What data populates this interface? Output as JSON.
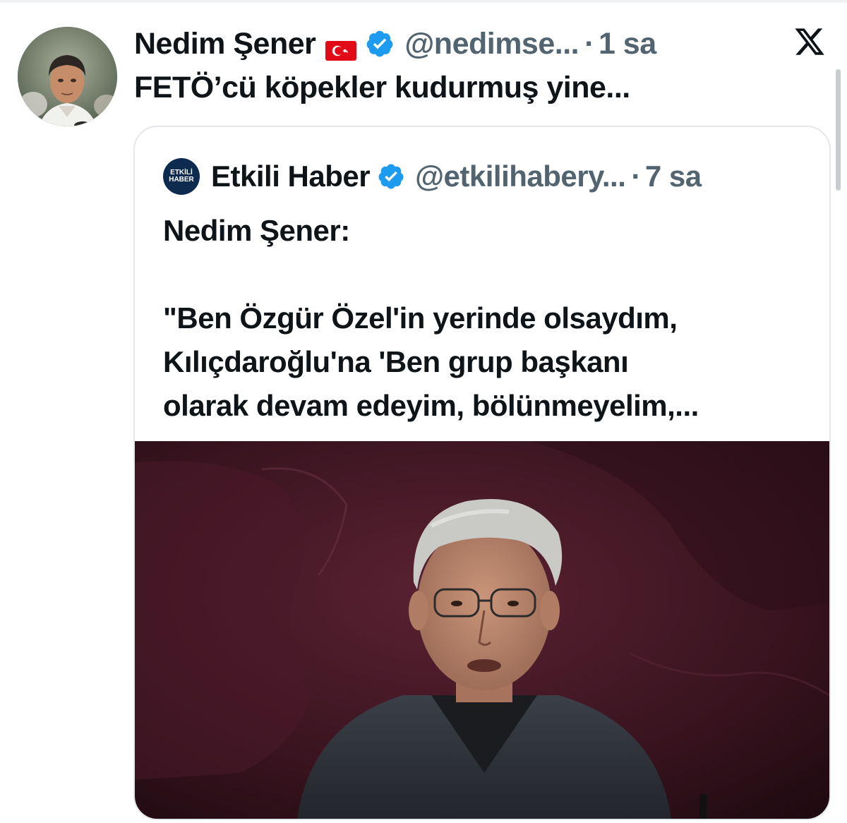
{
  "post": {
    "display_name": "Nedim Şener",
    "handle": "@nedimse...",
    "separator": "·",
    "time": "1 sa",
    "text": "FETÖ’cü köpekler kudurmuş yine...",
    "flag_icon": "turkey-flag-icon",
    "verified_icon": "verified-badge-icon",
    "platform_icon": "x-logo-icon"
  },
  "quote": {
    "avatar_text_1": "ETKİLİ",
    "avatar_text_2": "HABER",
    "display_name": "Etkili Haber",
    "handle": "@etkilihabery...",
    "separator": "·",
    "time": "7 sa",
    "lines": [
      "Nedim Şener:",
      "",
      "\"Ben Özgür Özel'in yerinde olsaydım,",
      "Kılıçdaroğlu'na 'Ben grup başkanı",
      "olarak devam edeyim, bölünmeyelim,..."
    ]
  },
  "colors": {
    "text_primary": "#0f1419",
    "text_secondary": "#536471",
    "verified_blue": "#1d9bf0",
    "card_border": "#e4e8eb",
    "image_background": "#3a1420"
  }
}
